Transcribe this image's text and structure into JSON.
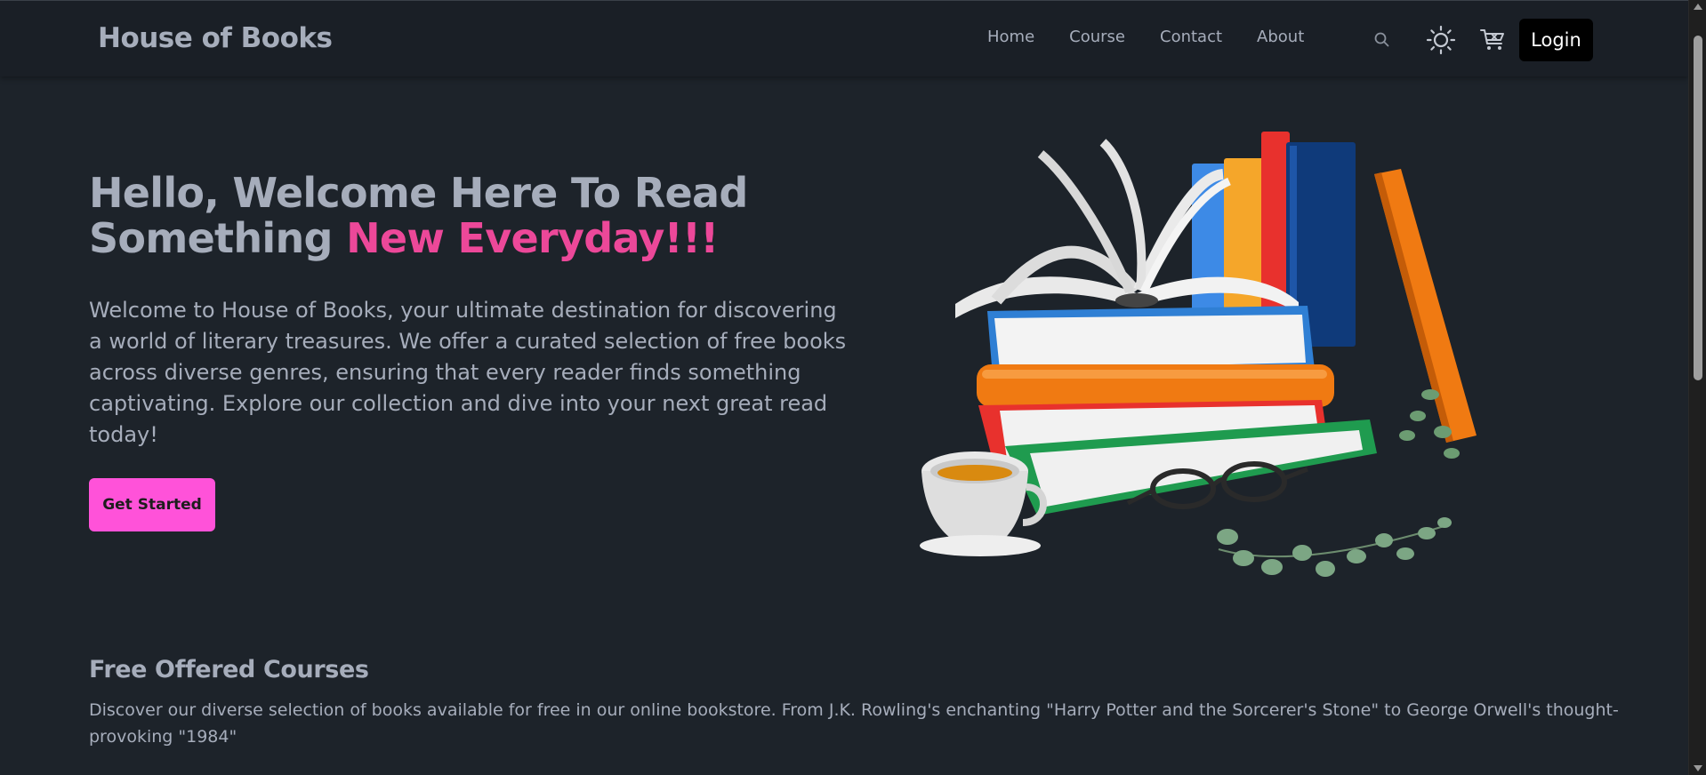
{
  "navbar": {
    "brand": "House of Books",
    "links": [
      "Home",
      "Course",
      "Contact",
      "About"
    ],
    "login_label": "Login"
  },
  "hero": {
    "title_line1": "Hello, Welcome Here To Read",
    "title_line2_plain": "Something ",
    "title_line2_accent": "New Everyday!!!",
    "description": "Welcome to House of Books, your ultimate destination for discovering a world of literary treasures. We offer a curated selection of free books across diverse genres, ensuring that every reader finds something captivating. Explore our collection and dive into your next great read today!",
    "cta_label": "Get Started"
  },
  "courses": {
    "title": "Free Offered Courses",
    "description": "Discover our diverse selection of books available for free in our online bookstore. From J.K. Rowling's enchanting \"Harry Potter and the Sorcerer's Stone\" to George Orwell's thought-provoking \"1984\""
  },
  "colors": {
    "background": "#1d232a",
    "navbar": "#1a1f26",
    "text": "#a6adbb",
    "accent_pink": "#ec4899",
    "cta_pink": "#ff52d9",
    "login_bg": "#000000"
  },
  "icons": [
    "search-icon",
    "sun-icon",
    "cart-icon"
  ]
}
